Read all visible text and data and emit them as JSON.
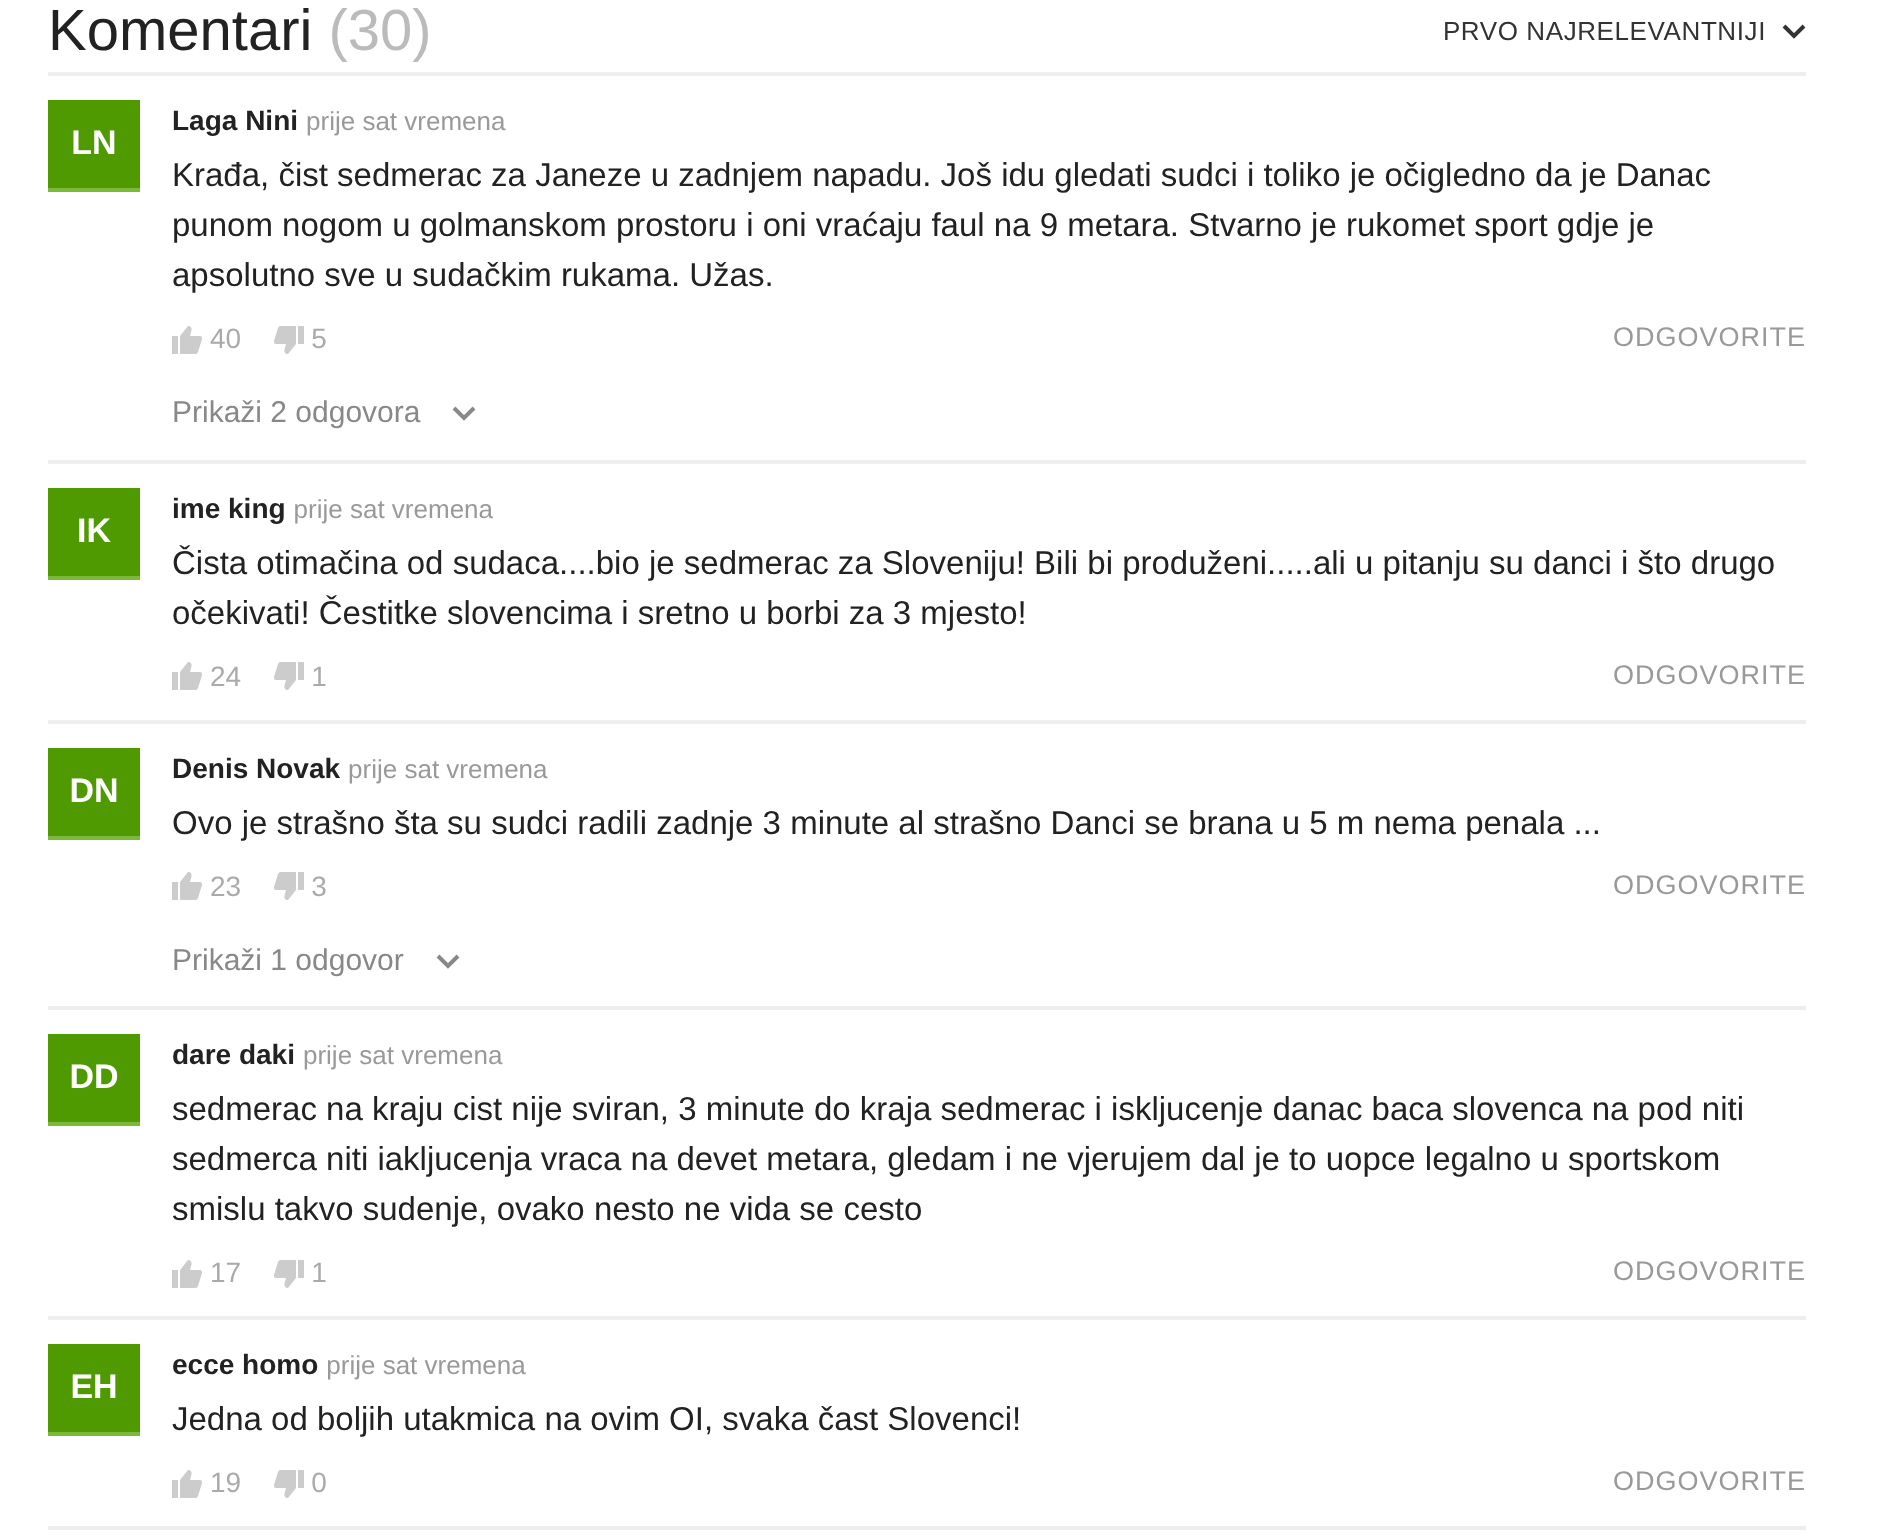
{
  "header": {
    "title": "Komentari",
    "count": "(30)",
    "sort": "PRVO NAJRELEVANTNIJI"
  },
  "comments": [
    {
      "initials": "LN",
      "author": "Laga Nini",
      "time": "prije sat vremena",
      "text": "Krađa, čist sedmerac za Janeze u zadnjem napadu. Još idu gledati sudci i toliko je očigledno da je Danac punom nogom u golmanskom prostoru i oni vraćaju faul na 9 metara. Stvarno je rukomet sport gdje je apsolutno sve u sudačkim rukama. Užas.",
      "likes": "40",
      "dislikes": "5",
      "reply": "ODGOVORITE",
      "replies": "Prikaži 2 odgovora"
    },
    {
      "initials": "IK",
      "author": "ime king",
      "time": "prije sat vremena",
      "text": "Čista otimačina od sudaca....bio je sedmerac za Sloveniju! Bili bi produženi.....ali u pitanju su danci i što drugo očekivati! Čestitke slovencima i sretno u borbi za 3 mjesto!",
      "likes": "24",
      "dislikes": "1",
      "reply": "ODGOVORITE"
    },
    {
      "initials": "DN",
      "author": "Denis Novak",
      "time": "prije sat vremena",
      "text": "Ovo je strašno šta su sudci radili zadnje 3 minute al strašno Danci se brana u 5 m nema penala ...",
      "likes": "23",
      "dislikes": "3",
      "reply": "ODGOVORITE",
      "replies": "Prikaži 1 odgovor"
    },
    {
      "initials": "DD",
      "author": "dare daki",
      "time": "prije sat vremena",
      "text": "sedmerac na kraju cist nije sviran, 3 minute do kraja sedmerac i iskljucenje danac baca slovenca na pod niti sedmerca niti iakljucenja vraca na devet metara, gledam i ne vjerujem dal je to uopce legalno u sportskom smislu takvo sudenje, ovako nesto ne vida se cesto",
      "likes": "17",
      "dislikes": "1",
      "reply": "ODGOVORITE"
    },
    {
      "initials": "EH",
      "author": "ecce homo",
      "time": "prije sat vremena",
      "text": "Jedna od boljih utakmica na ovim OI, svaka čast Slovenci!",
      "likes": "19",
      "dislikes": "0",
      "reply": "ODGOVORITE"
    }
  ]
}
